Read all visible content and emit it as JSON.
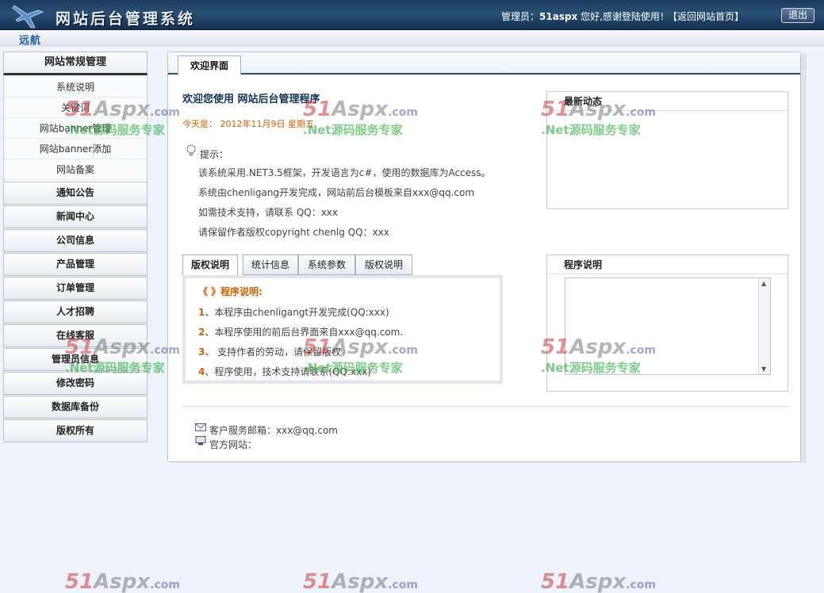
{
  "header": {
    "logo_text": "远航",
    "system_title": "网站后台管理系统",
    "admin_prefix": "管理员：",
    "admin_name": "51aspx",
    "admin_suffix": " 您好,感谢登陆使用！",
    "back_link": "【返回网站首页】",
    "logout_label": "退出"
  },
  "sidebar": {
    "head": "网站常规管理",
    "sub_items": [
      "系统说明",
      "关键词",
      "网站banner管理",
      "网站banner添加",
      "网站备案"
    ],
    "items": [
      "通知公告",
      "新闻中心",
      "公司信息",
      "产品管理",
      "订单管理",
      "人才招聘",
      "在线客服",
      "管理员信息",
      "修改密码",
      "数据库备份",
      "版权所有"
    ]
  },
  "main": {
    "tab_label": "欢迎界面",
    "welcome_title": "欢迎您使用 网站后台管理程序",
    "today_prefix": "今天是：",
    "today_value": "2012年11月9日 星期五",
    "tip_label": "提示：",
    "tips": [
      "该系统采用.NET3.5框架，开发语言为c#，使用的数据库为Access。",
      "系统由chenligang开发完成，网站前后台模板来自xxx@qq.com",
      "如需技术支持，请联系  QQ：xxx",
      "请保留作者版权copyright chenlg QQ：xxx"
    ],
    "news_box_title": "最新动态",
    "program_box_title": "程序说明",
    "subtabs": [
      "版权说明",
      "统计信息",
      "系统参数",
      "版权说明"
    ],
    "notes_title": "《 》程序说明:",
    "notes": [
      {
        "num": "1",
        "text": "、本程序由chenligangt开发完成(QQ:xxx)"
      },
      {
        "num": "2",
        "text": "、本程序使用的前后台界面来自xxx@qq.com."
      },
      {
        "num": "3",
        "text": "、  支持作者的劳动，请保留版权。"
      },
      {
        "num": "4",
        "text": "、程序使用，技术支持请联系(QQ:xxx)"
      }
    ],
    "footer_email": "客户服务邮箱：xxx@qq.com",
    "footer_site": "官方网站："
  },
  "watermark": {
    "num": "51",
    "aspx": "Aspx",
    "com": ".com",
    "sub": ".Net源码服务专家"
  },
  "icons": {
    "logo": "plane-icon",
    "tip": "lightbulb-icon",
    "email": "envelope-icon",
    "site": "computer-icon"
  }
}
